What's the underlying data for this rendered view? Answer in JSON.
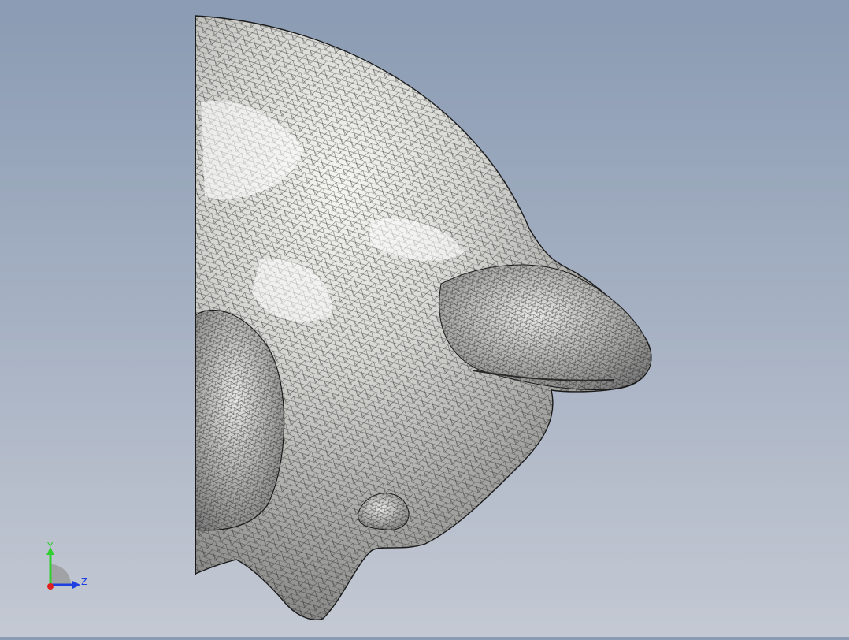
{
  "viewport": {
    "model": "tessellated-head-mesh",
    "background_top": "#8a9bb3",
    "background_bottom": "#c4c9d3"
  },
  "triad": {
    "y_label": "Y",
    "z_label": "Z",
    "y_color": "#2fcf2f",
    "z_color": "#1f3fe0",
    "x_color": "#e02020"
  }
}
